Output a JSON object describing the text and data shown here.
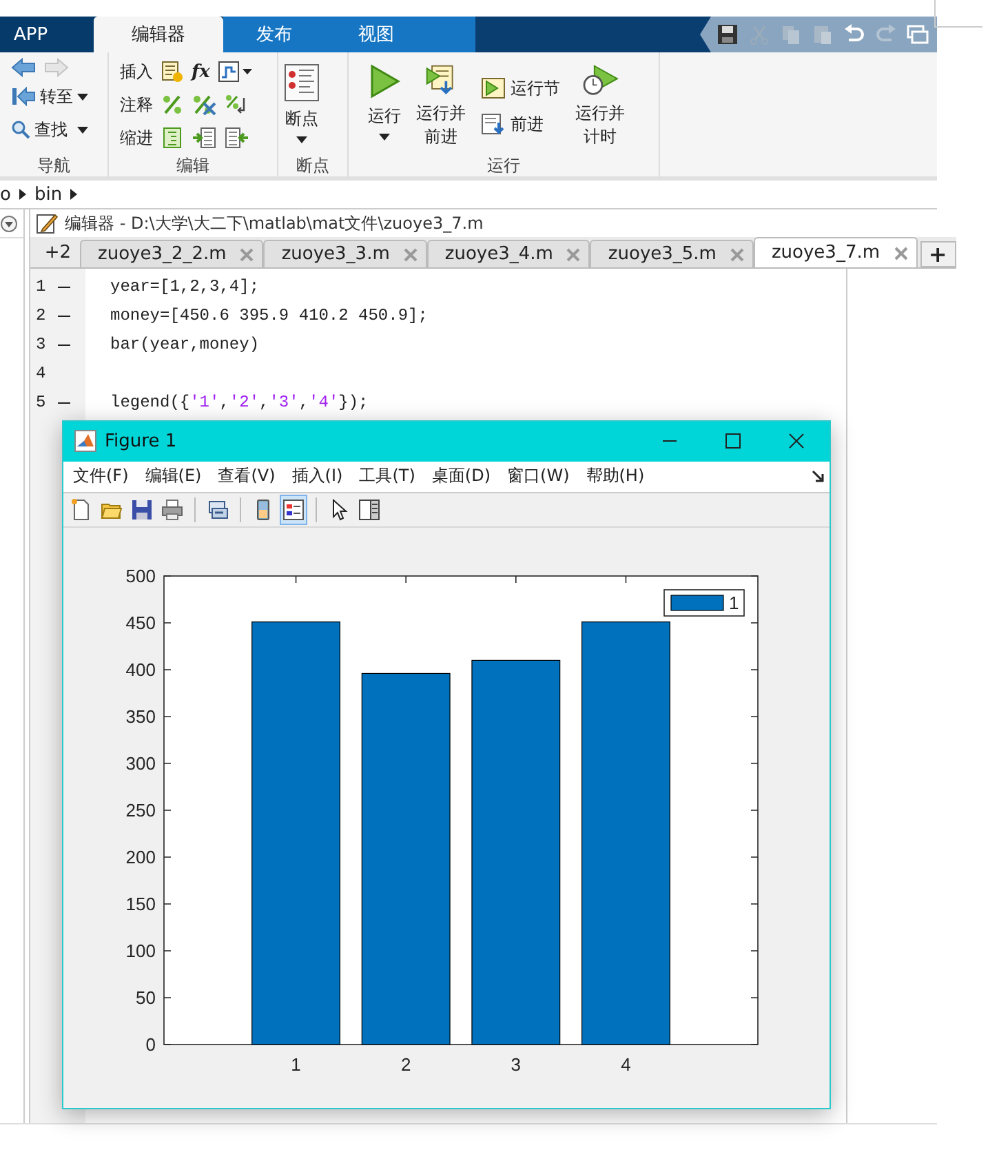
{
  "ribbon": {
    "tabs": [
      {
        "label": "APP",
        "selected": false
      },
      {
        "label": "编辑器",
        "selected": true
      },
      {
        "label": "发布",
        "selected": false
      },
      {
        "label": "视图",
        "selected": false
      }
    ],
    "nav": {
      "goto": "转至",
      "find": "查找",
      "label": "导航"
    },
    "edit": {
      "rows": [
        {
          "label": "插入"
        },
        {
          "label": "注释"
        },
        {
          "label": "缩进"
        }
      ],
      "fx": "fx",
      "label": "编辑"
    },
    "breakpoints": {
      "button": "断点",
      "label": "断点"
    },
    "run": {
      "run": "运行",
      "run_advance": "运行并前进",
      "run_section": "运行节",
      "advance": "前进",
      "run_time": "运行并计时",
      "label": "运行"
    }
  },
  "breadcrumb": [
    "o",
    "bin"
  ],
  "editor": {
    "title": "编辑器 - D:\\大学\\大二下\\matlab\\mat文件\\zuoye3_7.m",
    "overflow": "+2",
    "tabs": [
      {
        "label": "zuoye3_2_2.m",
        "selected": false
      },
      {
        "label": "zuoye3_3.m",
        "selected": false
      },
      {
        "label": "zuoye3_4.m",
        "selected": false
      },
      {
        "label": "zuoye3_5.m",
        "selected": false
      },
      {
        "label": "zuoye3_7.m",
        "selected": true
      }
    ],
    "add": "+",
    "lines": [
      {
        "number": "1",
        "executable": true,
        "parts": [
          {
            "kind": "plain",
            "text": "year=[1,2,3,4];"
          }
        ]
      },
      {
        "number": "2",
        "executable": true,
        "parts": [
          {
            "kind": "plain",
            "text": "money=[450.6 395.9 410.2 450.9];"
          }
        ]
      },
      {
        "number": "3",
        "executable": true,
        "parts": [
          {
            "kind": "plain",
            "text": "bar(year,money)"
          }
        ]
      },
      {
        "number": "4",
        "executable": false
      },
      {
        "number": "5",
        "executable": true,
        "parts": [
          {
            "kind": "plain",
            "text": "legend({"
          },
          {
            "kind": "string",
            "text": "'1'"
          },
          {
            "kind": "plain",
            "text": ","
          },
          {
            "kind": "string",
            "text": "'2'"
          },
          {
            "kind": "plain",
            "text": ","
          },
          {
            "kind": "string",
            "text": "'3'"
          },
          {
            "kind": "plain",
            "text": ","
          },
          {
            "kind": "string",
            "text": "'4'"
          },
          {
            "kind": "plain",
            "text": "});"
          }
        ]
      }
    ]
  },
  "figure": {
    "title": "Figure 1",
    "menu": [
      "文件(F)",
      "编辑(E)",
      "查看(V)",
      "插入(I)",
      "工具(T)",
      "桌面(D)",
      "窗口(W)",
      "帮助(H)"
    ],
    "toolbar": [
      {
        "pressed": false
      },
      {
        "pressed": false
      },
      {
        "pressed": false
      },
      {
        "pressed": false
      },
      {
        "pressed": false
      },
      {
        "pressed": false
      },
      {
        "pressed": true
      },
      {
        "pressed": false
      },
      {
        "pressed": false
      }
    ],
    "chart_data": {
      "type": "bar",
      "categories": [
        "1",
        "2",
        "3",
        "4"
      ],
      "series": [
        {
          "name": "1",
          "color": "#0072bd",
          "values": [
            451,
            396,
            410,
            451
          ]
        }
      ],
      "ylim": [
        0,
        500
      ],
      "yticks": [
        0,
        50,
        100,
        150,
        200,
        250,
        300,
        350,
        400,
        450,
        500
      ]
    }
  }
}
